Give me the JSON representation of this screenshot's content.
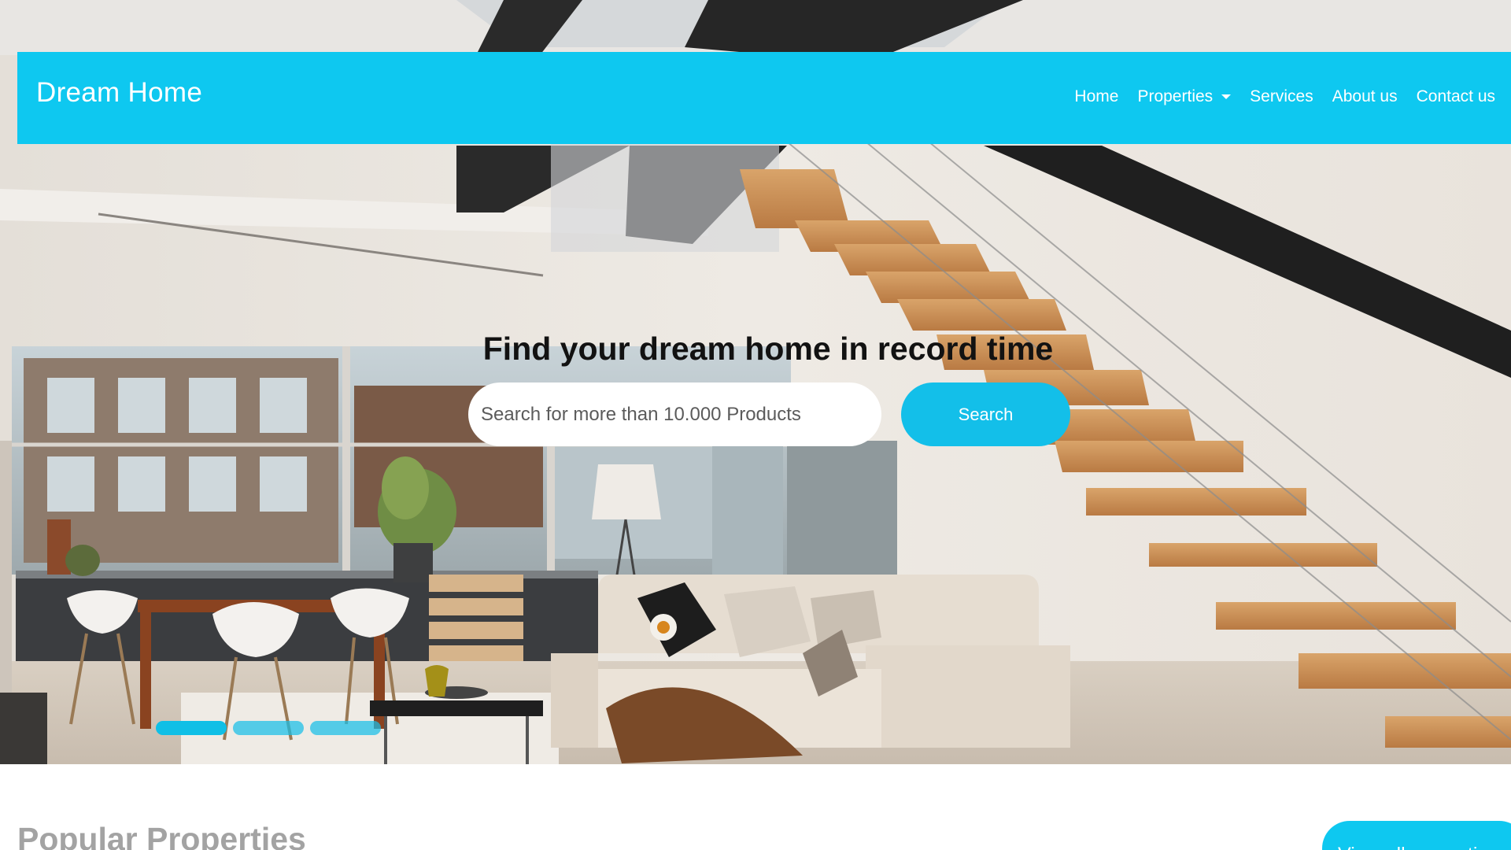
{
  "brand": {
    "name": "Dream Home"
  },
  "nav": {
    "items": [
      {
        "label": "Home"
      },
      {
        "label": "Properties",
        "has_dropdown": true
      },
      {
        "label": "Services"
      },
      {
        "label": "About us"
      },
      {
        "label": "Contact us"
      }
    ]
  },
  "hero": {
    "headline": "Find your dream home in record time",
    "search": {
      "placeholder": "Search for more than 10.000 Products",
      "value": "",
      "button_label": "Search"
    },
    "carousel": {
      "slide_count": 3,
      "active_index": 0
    }
  },
  "popular": {
    "title": "Popular Properties",
    "view_all_label": "View all properties"
  },
  "colors": {
    "accent": "#0ec8f0",
    "button": "#13bfe9",
    "headline": "#121212",
    "section_title": "#a3a3a3"
  },
  "icons": {
    "dropdown": "caret-down-icon"
  }
}
